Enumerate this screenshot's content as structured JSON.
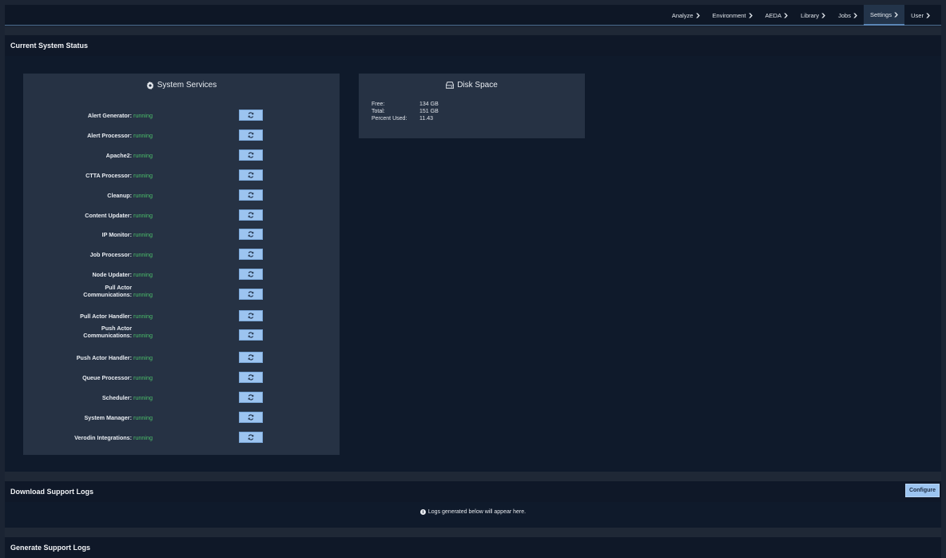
{
  "nav": {
    "items": [
      {
        "label": "Analyze"
      },
      {
        "label": "Environment"
      },
      {
        "label": "AEDA"
      },
      {
        "label": "Library"
      },
      {
        "label": "Jobs"
      },
      {
        "label": "Settings",
        "active": true
      },
      {
        "label": "User"
      }
    ]
  },
  "status_panel": {
    "title": "Current System Status",
    "services_card": {
      "title": "System Services",
      "services": [
        {
          "name": "Alert Generator:",
          "status": "running"
        },
        {
          "name": "Alert Processor:",
          "status": "running"
        },
        {
          "name": "Apache2:",
          "status": "running"
        },
        {
          "name": "CTTA Processor:",
          "status": "running"
        },
        {
          "name": "Cleanup:",
          "status": "running"
        },
        {
          "name": "Content Updater:",
          "status": "running"
        },
        {
          "name": "IP Monitor:",
          "status": "running"
        },
        {
          "name": "Job Processor:",
          "status": "running"
        },
        {
          "name": "Node Updater:",
          "status": "running"
        },
        {
          "name_line1": "Pull Actor",
          "name": "Communications:",
          "status": "running"
        },
        {
          "name": "Pull Actor Handler:",
          "status": "running"
        },
        {
          "name_line1": "Push Actor",
          "name": "Communications:",
          "status": "running"
        },
        {
          "name": "Push Actor Handler:",
          "status": "running"
        },
        {
          "name": "Queue Processor:",
          "status": "running"
        },
        {
          "name": "Scheduler:",
          "status": "running"
        },
        {
          "name": "System Manager:",
          "status": "running"
        },
        {
          "name": "Verodin Integrations:",
          "status": "running"
        }
      ]
    },
    "disk_card": {
      "title": "Disk Space",
      "rows": [
        {
          "label": "Free:",
          "value": "134 GB"
        },
        {
          "label": "Total:",
          "value": "151 GB"
        },
        {
          "label": "Percent Used:",
          "value": "11.43"
        }
      ]
    }
  },
  "download_panel": {
    "title": "Download Support Logs",
    "configure_label": "Configure",
    "note": "Logs generated below will appear here."
  },
  "generate_panel": {
    "title": "Generate Support Logs"
  },
  "colors": {
    "running": "#4cbf6a",
    "button": "#9cc4f0"
  }
}
